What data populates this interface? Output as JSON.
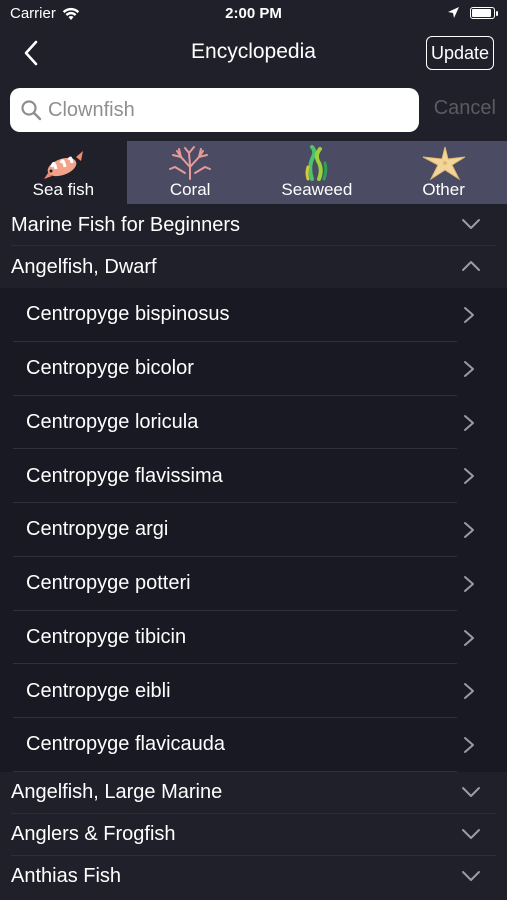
{
  "status_bar": {
    "carrier": "Carrier",
    "time": "2:00 PM",
    "battery_level": 0.95
  },
  "nav": {
    "title": "Encyclopedia",
    "update_label": "Update"
  },
  "search": {
    "placeholder": "Clownfish",
    "cancel_label": "Cancel"
  },
  "tabs": [
    {
      "label": "Sea fish",
      "icon": "clownfish-icon",
      "active": true
    },
    {
      "label": "Coral",
      "icon": "coral-icon",
      "active": false
    },
    {
      "label": "Seaweed",
      "icon": "seaweed-icon",
      "active": false
    },
    {
      "label": "Other",
      "icon": "starfish-icon",
      "active": false
    }
  ],
  "sections": [
    {
      "title": "Marine Fish for Beginners",
      "expanded": false,
      "items": []
    },
    {
      "title": "Angelfish, Dwarf",
      "expanded": true,
      "items": [
        "Centropyge bispinosus",
        "Centropyge bicolor",
        "Centropyge loricula",
        "Centropyge flavissima",
        "Centropyge argi",
        "Centropyge potteri",
        "Centropyge tibicin",
        "Centropyge eibli",
        "Centropyge flavicauda"
      ]
    },
    {
      "title": "Angelfish, Large Marine",
      "expanded": false,
      "items": []
    },
    {
      "title": "Anglers & Frogfish",
      "expanded": false,
      "items": []
    },
    {
      "title": "Anthias Fish",
      "expanded": false,
      "items": []
    }
  ],
  "colors": {
    "background": "#1f2029",
    "tab_bar": "#4b4c63",
    "row_background": "#181922",
    "cancel": "#5a5b63"
  }
}
